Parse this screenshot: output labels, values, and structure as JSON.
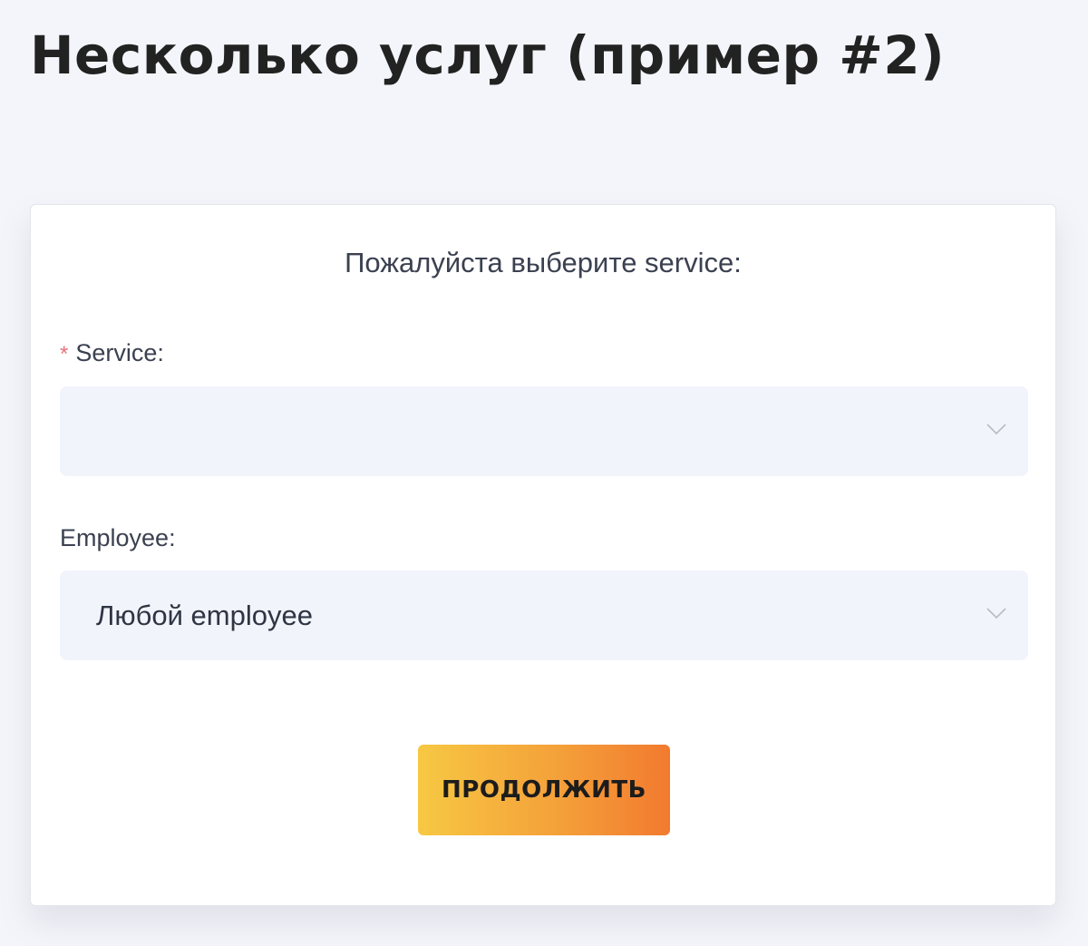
{
  "page": {
    "title": "Несколько услуг (пример #2)"
  },
  "form": {
    "prompt": "Пожалуйста выберите service:",
    "service": {
      "required_mark": "*",
      "label": "Service:",
      "value": "",
      "icon": "chevron-down-icon"
    },
    "employee": {
      "label": "Employee:",
      "value": "Любой employee",
      "icon": "chevron-down-icon"
    },
    "submit_label": "ПРОДОЛЖИТЬ"
  },
  "colors": {
    "background": "#f4f5fa",
    "card": "#ffffff",
    "field_background": "#f1f4fb",
    "required_mark": "#e8727b",
    "button_gradient_start": "#f7c843",
    "button_gradient_end": "#f27a2f"
  }
}
